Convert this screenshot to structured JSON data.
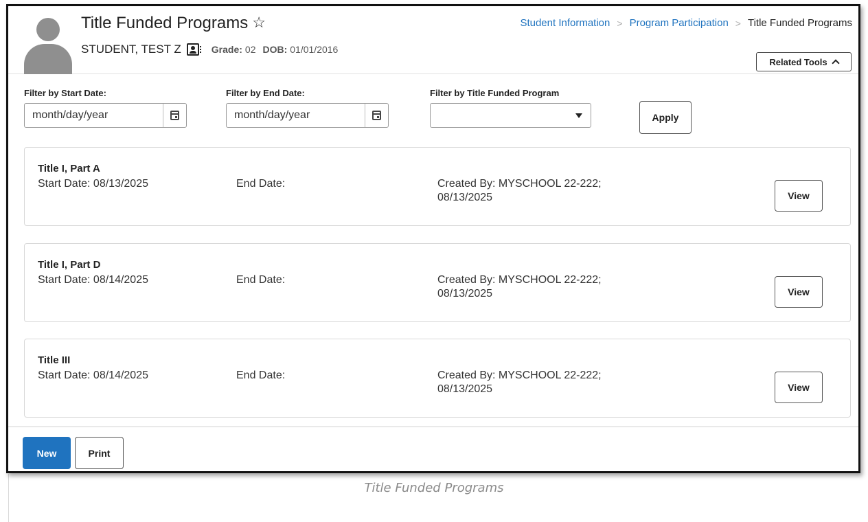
{
  "header": {
    "title": "Title Funded Programs",
    "student_name": "STUDENT, TEST Z",
    "grade_label": "Grade:",
    "grade_value": "02",
    "dob_label": "DOB:",
    "dob_value": "01/01/2016",
    "breadcrumb": [
      "Student Information",
      "Program Participation",
      "Title Funded Programs"
    ],
    "related_tools_label": "Related Tools"
  },
  "filters": {
    "start_label": "Filter by Start Date:",
    "start_placeholder": "month/day/year",
    "end_label": "Filter by End Date:",
    "end_placeholder": "month/day/year",
    "program_label": "Filter by Title Funded Program",
    "program_value": "",
    "apply_label": "Apply"
  },
  "programs": [
    {
      "title": "Title I, Part A",
      "start": "Start Date: 08/13/2025",
      "end": "End Date:",
      "created_line1": "Created By: MYSCHOOL 22-222;",
      "created_line2": "08/13/2025",
      "view_label": "View"
    },
    {
      "title": "Title I, Part D",
      "start": "Start Date: 08/14/2025",
      "end": "End Date:",
      "created_line1": "Created By: MYSCHOOL 22-222;",
      "created_line2": "08/13/2025",
      "view_label": "View"
    },
    {
      "title": "Title III",
      "start": "Start Date: 08/14/2025",
      "end": "End Date:",
      "created_line1": "Created By: MYSCHOOL 22-222;",
      "created_line2": "08/13/2025",
      "view_label": "View"
    }
  ],
  "footer": {
    "new_label": "New",
    "print_label": "Print"
  },
  "caption": "Title Funded Programs",
  "icons": {
    "favorite": "star-outline-icon",
    "contact": "contact-card-icon",
    "calendar": "calendar-icon",
    "dropdown": "caret-down-icon",
    "related_tools": "chevron-up-icon"
  },
  "colors": {
    "link": "#1f73bf",
    "primary_button": "#1f73bf"
  }
}
